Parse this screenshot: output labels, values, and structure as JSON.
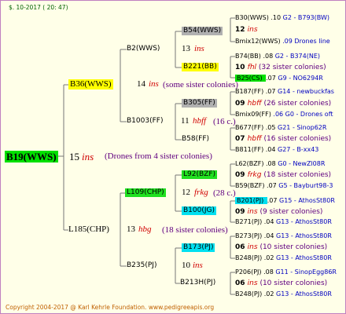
{
  "header_text": "$. 10-2017 ( 20: 47)",
  "footer_text": "Copyright 2004-2017 @ Karl Kehrle Foundation.   www.pedigreeapis.org",
  "root": {
    "name": "B19(WWS)",
    "num": "15",
    "code": "ins",
    "note": "(Drones from 4 sister colonies)"
  },
  "gen1": {
    "top": {
      "name": "B36(WWS)",
      "num": "14",
      "code": "ins",
      "note": "(some sister colonies)"
    },
    "bottom": {
      "name": "L185(CHP)",
      "num": "13",
      "code": "hbg",
      "note": "(18 sister colonies)"
    }
  },
  "gen2": {
    "a": {
      "name": "B2(WWS)",
      "num": "13",
      "code": "ins"
    },
    "b": {
      "name": "B1003(FF)",
      "num": "11",
      "code": "hbff",
      "note": "(16 c.)"
    },
    "c": {
      "name": "L109(CHP)",
      "num": "12",
      "code": "frkg",
      "note": "(28 c.)"
    },
    "d": {
      "name": "B235(PJ)",
      "num": "10",
      "code": "ins"
    }
  },
  "gen3": {
    "a1": {
      "name": "B54(WWS)",
      "num": "12",
      "code": "ins"
    },
    "a2": {
      "name": "B221(BB)"
    },
    "b1": {
      "name": "B305(FF)",
      "num": "09",
      "code": "hbff"
    },
    "b2": {
      "name": "B58(FF)",
      "num": "07",
      "code": "hbff"
    },
    "c1": {
      "name": "L92(BZF)",
      "num": "09",
      "code": "frkg"
    },
    "c2": {
      "name": "B100(JG)",
      "num": "10",
      "code": "ins"
    },
    "d1": {
      "name": "B173(PJ)",
      "num": "06",
      "code": "ins"
    },
    "d2": {
      "name": "B213H(PJ)",
      "num": "06",
      "code": "ins"
    }
  },
  "gen4": [
    {
      "name": "B30(WWS)",
      "year": ".10",
      "ref": "G2 - B793(BW)"
    },
    {
      "name": "12",
      "code": "ins",
      "note": ""
    },
    {
      "name": "Bmix12(WWS)",
      "ref": ".09 Drones line"
    },
    {
      "name": "B74(BB)",
      "year": ".08",
      "ref": "G2 - B374(NE)"
    },
    {
      "name": "10",
      "code": "fhl",
      "note": "(32 sister colonies)"
    },
    {
      "name": "B25(CS)",
      "year": ".07",
      "ref": "G9 - NO6294R"
    },
    {
      "name": "B187(FF)",
      "year": ".07",
      "ref": "G14 - newbuckfas"
    },
    {
      "name": "09",
      "code": "hbff",
      "note": "(26 sister colonies)"
    },
    {
      "name": "Bmix09(FF)",
      "ref": ".06 G0 - Drones oft"
    },
    {
      "name": "B677(FF)",
      "year": ".05",
      "ref": "G21 - Sinop62R"
    },
    {
      "name": "07",
      "code": "hbff",
      "note": "(16 sister colonies)"
    },
    {
      "name": "B811(FF)",
      "year": ".04",
      "ref": "G27 - B-xx43"
    },
    {
      "name": "L62(BZF)",
      "year": ".08",
      "ref": "G0 - NewZl08R"
    },
    {
      "name": "09",
      "code": "frkg",
      "note": "(18 sister colonies)"
    },
    {
      "name": "B59(BZF)",
      "year": ".07",
      "ref": "G5 - Bayburt98-3"
    },
    {
      "name": "B201(PJ)",
      "year": ".07",
      "ref": "G15 - AthosSt80R"
    },
    {
      "name": "09",
      "code": "ins",
      "note": "(9 sister colonies)"
    },
    {
      "name": "B271(PJ)",
      "year": ".04",
      "ref": "G13 - AthosSt80R"
    },
    {
      "name": "B273(PJ)",
      "year": ".04",
      "ref": "G13 - AthosSt80R"
    },
    {
      "name": "06",
      "code": "ins",
      "note": "(10 sister colonies)"
    },
    {
      "name": "B248(PJ)",
      "year": ".02",
      "ref": "G13 - AthosSt80R"
    },
    {
      "name": "P206(PJ)",
      "year": ".08",
      "ref": "G11 - SinopEgg86R"
    },
    {
      "name": "06",
      "code": "ins",
      "note": "(10 sister colonies)"
    },
    {
      "name": "B248(PJ)",
      "year": ".02",
      "ref": "G13 - AthosSt80R"
    }
  ],
  "colors": {
    "frame": "#c080c0",
    "background": "#ffffe8",
    "yellow": "#ffff00",
    "green": "#00e000",
    "gray": "#b0b0b0",
    "cyan": "#00e0f0",
    "note": "#600080",
    "ref": "#0000c0"
  }
}
